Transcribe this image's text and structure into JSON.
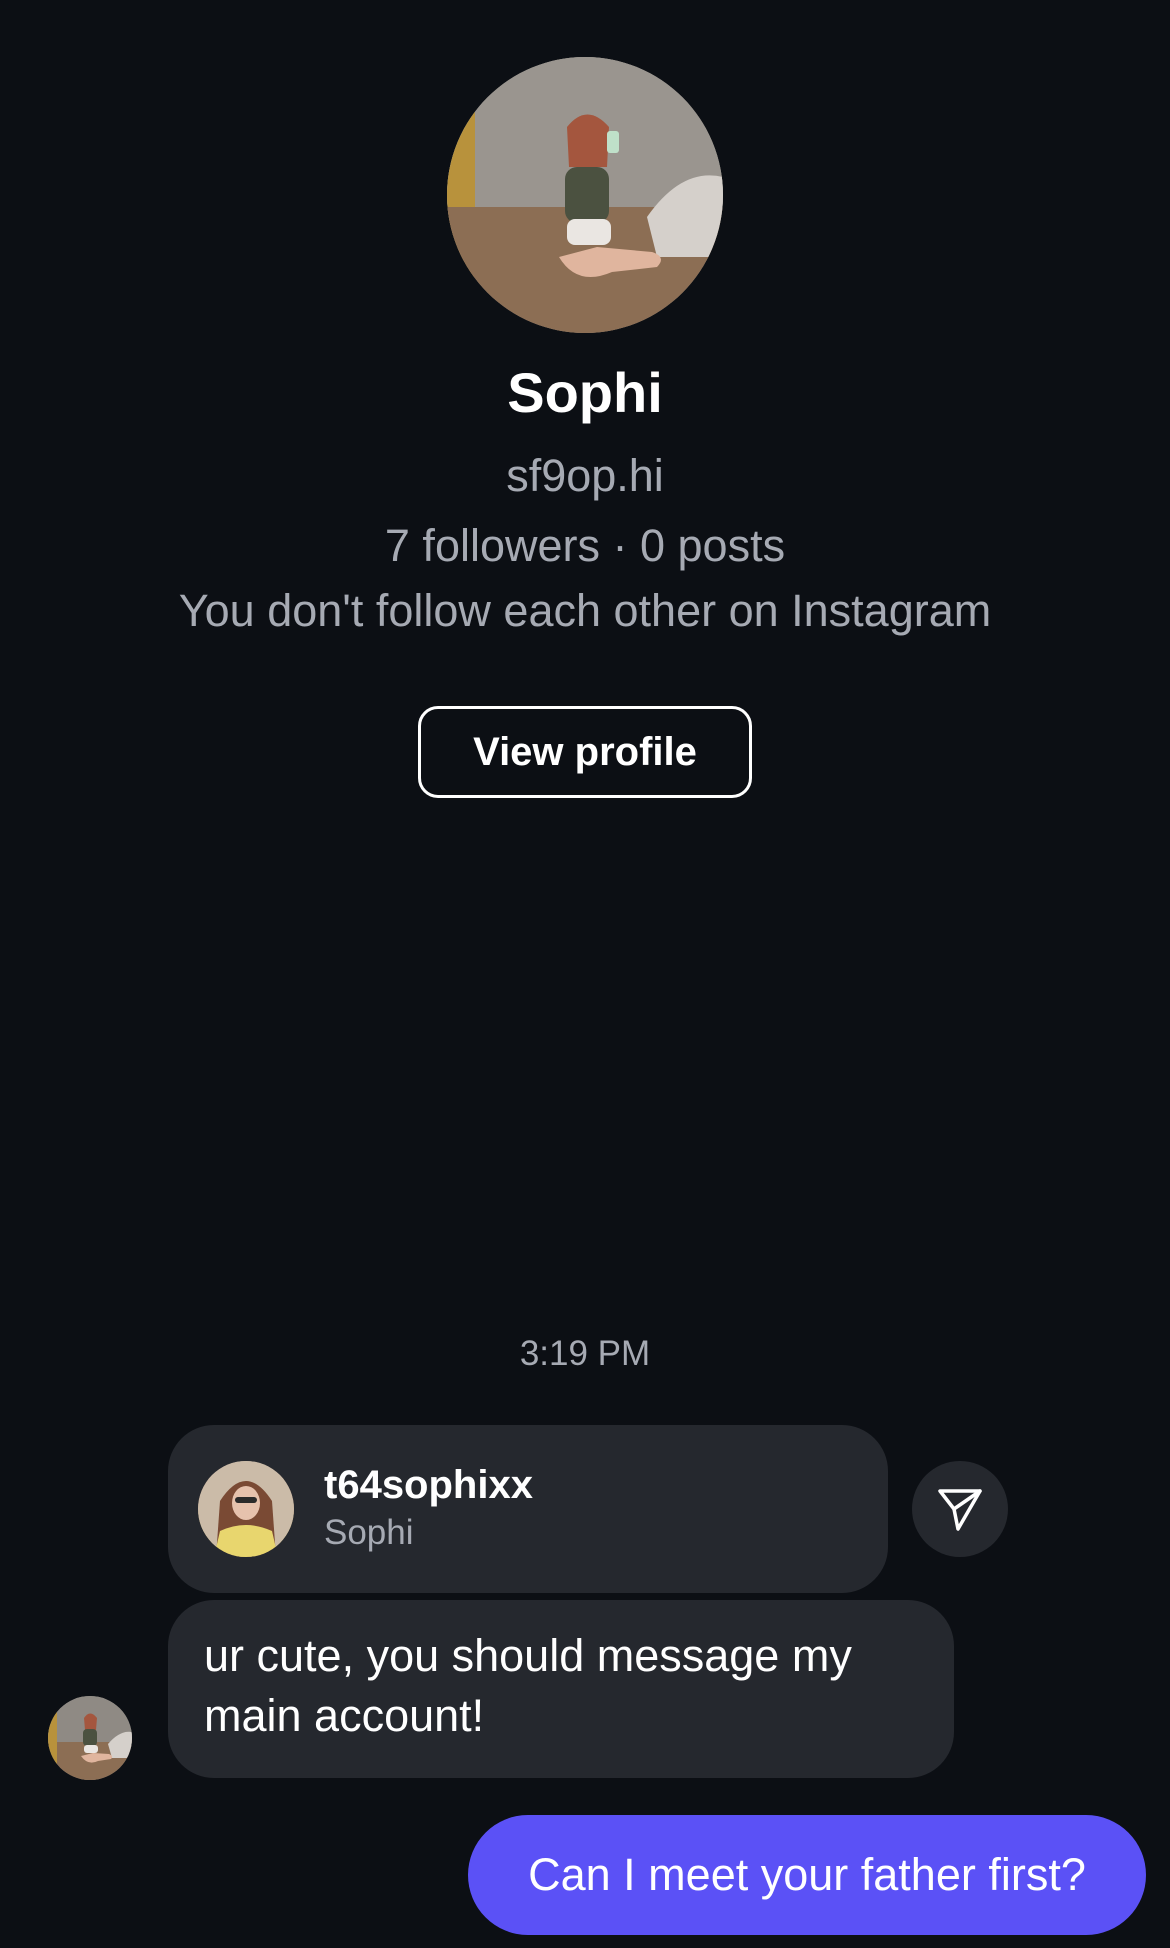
{
  "profile": {
    "name": "Sophi",
    "handle": "sf9op.hi",
    "stats": "7 followers · 0 posts",
    "relationship": "You don't follow each other on Instagram",
    "view_profile_label": "View profile"
  },
  "conversation": {
    "timestamp": "3:19 PM",
    "shared_profile": {
      "username": "t64sophixx",
      "display_name": "Sophi"
    },
    "incoming_message": "ur cute, you should message my main account!",
    "outgoing_message": "Can I meet your father first?"
  },
  "icons": {
    "share": "send-icon"
  },
  "colors": {
    "background": "#0c0f14",
    "bubble_incoming": "#25282e",
    "bubble_outgoing": "#5b51f6",
    "secondary_text": "#a6aab3"
  }
}
